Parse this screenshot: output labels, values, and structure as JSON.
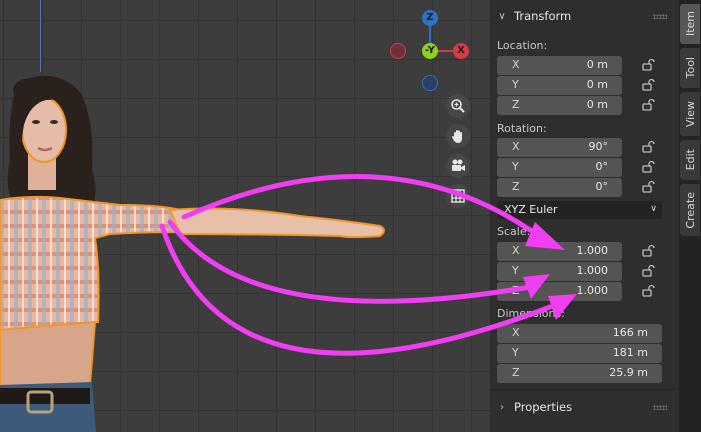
{
  "viewport": {
    "gizmo": {
      "z": "Z",
      "y": "-Y",
      "x": "X"
    },
    "nav_icons": [
      "zoom-icon",
      "hand-pan-icon",
      "camera-icon",
      "grid-view-icon"
    ],
    "colors": {
      "x_axis": "#d73a46",
      "y_axis": "#8ad31a",
      "z_axis": "#2d72c5",
      "selection_outline": "#f0962a",
      "annotation_arrow": "#f13ef3"
    }
  },
  "panel": {
    "transform_title": "Transform",
    "location_label": "Location:",
    "location": [
      {
        "axis": "X",
        "value": "0 m"
      },
      {
        "axis": "Y",
        "value": "0 m"
      },
      {
        "axis": "Z",
        "value": "0 m"
      }
    ],
    "rotation_label": "Rotation:",
    "rotation": [
      {
        "axis": "X",
        "value": "90°"
      },
      {
        "axis": "Y",
        "value": "0°"
      },
      {
        "axis": "Z",
        "value": "0°"
      }
    ],
    "rotation_mode": "XYZ Euler",
    "scale_label": "Scale:",
    "scale": [
      {
        "axis": "X",
        "value": "1.000"
      },
      {
        "axis": "Y",
        "value": "1.000"
      },
      {
        "axis": "Z",
        "value": "1.000"
      }
    ],
    "dimensions_label": "Dimensions:",
    "dimensions": [
      {
        "axis": "X",
        "value": "166 m"
      },
      {
        "axis": "Y",
        "value": "181 m"
      },
      {
        "axis": "Z",
        "value": "25.9 m"
      }
    ],
    "properties_title": "Properties"
  },
  "tabs": [
    "Item",
    "Tool",
    "View",
    "Edit",
    "Create"
  ]
}
